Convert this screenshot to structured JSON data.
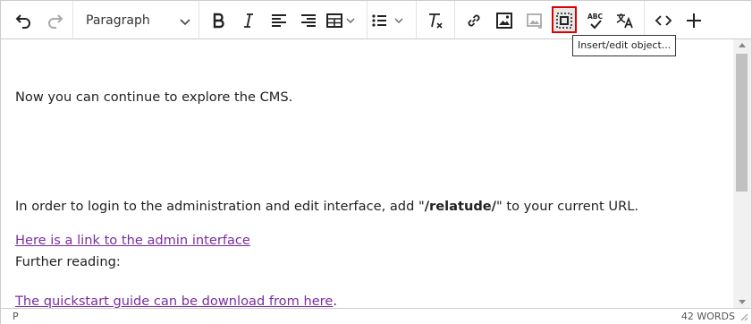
{
  "toolbar": {
    "block_format": "Paragraph",
    "buttons": [
      "undo",
      "redo",
      "bold",
      "italic",
      "align-left",
      "align-right",
      "table",
      "bullet-list",
      "clear-formatting",
      "link",
      "image",
      "media",
      "insert-edit-object",
      "spellcheck",
      "translate",
      "source-code",
      "insert"
    ],
    "tooltip": "Insert/edit object...",
    "highlight_color": "#e00000"
  },
  "content": {
    "line1": "Now you can continue to explore the CMS.",
    "line2_pre": "In order to login to the administration and edit interface, add \"",
    "line2_bold": "/relatude/",
    "line2_post": "\" to your current URL.",
    "link1": "Here is a link to the admin interface",
    "further": "Further reading:",
    "link2": "The quickstart guide can be download from here",
    "link2_after": ".",
    "link_color": "#7a2e9e"
  },
  "statusbar": {
    "path": "P",
    "word_count": "42 WORDS"
  }
}
